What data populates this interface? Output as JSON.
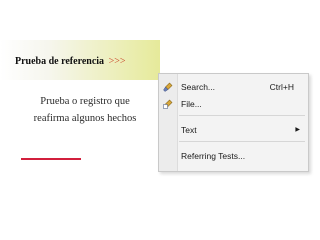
{
  "title": {
    "text": "Prueba de referencia",
    "arrows": ">>>"
  },
  "body": {
    "line1": "Prueba o registro que",
    "line2": "reafirma algunos hechos"
  },
  "menu": {
    "items": [
      {
        "label": "Search...",
        "shortcut": "Ctrl+H",
        "icon": "search-flashlight-icon"
      },
      {
        "label": "File...",
        "icon": "file-search-icon"
      },
      {
        "label": "Text",
        "submenu": true
      },
      {
        "label": "Referring Tests...",
        "highlight": true
      }
    ],
    "highlight_color": "#d21f3c",
    "accent_color": "#c9462b"
  }
}
